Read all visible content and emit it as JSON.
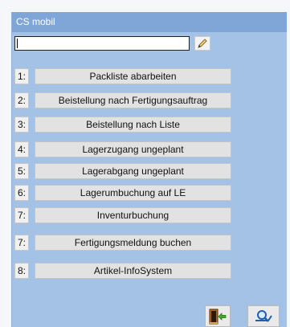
{
  "window": {
    "title": "CS mobil"
  },
  "input": {
    "value": ""
  },
  "menu": [
    {
      "num": "1:",
      "label": "Packliste abarbeiten"
    },
    {
      "num": "2:",
      "label": "Beistellung nach Fertigungsauftrag"
    },
    {
      "num": "3:",
      "label": "Beistellung nach Liste"
    },
    {
      "num": "4:",
      "label": "Lagerzugang ungeplant"
    },
    {
      "num": "5:",
      "label": "Lagerabgang ungeplant"
    },
    {
      "num": "6:",
      "label": "Lagerumbuchung auf LE"
    },
    {
      "num": "7:",
      "label": "Inventurbuchung"
    },
    {
      "num": "7:",
      "label": "Fertigungsmeldung buchen"
    },
    {
      "num": "8:",
      "label": "Artikel-InfoSystem"
    }
  ],
  "icons": {
    "edit": "pencil-icon",
    "exit": "exit-door-icon",
    "search": "magnifier-icon"
  },
  "colors": {
    "panel": "#a4c1e6",
    "titlebar": "#7fa6d6",
    "button": "#e2e2e2"
  }
}
